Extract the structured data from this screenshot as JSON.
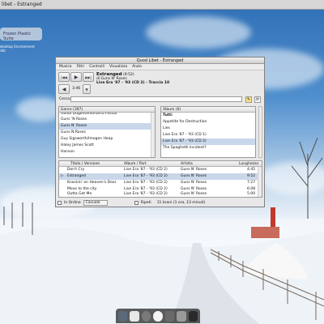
{
  "panel": {
    "title_fragment": "libet - Estranged"
  },
  "desktop": {
    "widget_label": "Frozen Plastic Suite",
    "caption1": "desktop Environment",
    "caption2": "rbit"
  },
  "window": {
    "title": "Quod Libet - Estranged",
    "menu": [
      "Musica",
      "Filtri",
      "Controlli",
      "Visualizza",
      "Aiuto"
    ],
    "now_playing": {
      "title": "Estranged",
      "length": "(9:52)",
      "artist": "di Guns N' Roses",
      "album": "Live Era '87 - '93 (CD 2) - Traccia 10"
    },
    "controls": {
      "prev": "|◀◀",
      "play": "▶",
      "next": "▶▶|",
      "volume_time": "3:46"
    },
    "search": {
      "label": "Cerca:"
    },
    "genre_pane": {
      "header": "Genre (397)",
      "items": [
        "Guido Dugentemonarco Fossat",
        "Guns 'N Roses",
        "Guns N' Roses",
        "Guns N Roses",
        "Guy Sigsworth/Imogen Heap",
        "Haley James Scott",
        "Hanson"
      ],
      "selected_index": 2
    },
    "album_pane": {
      "header": "Album (6)",
      "items": [
        "Tutti",
        "Appetite for Destruction",
        "Lies",
        "Live Era '87 - '93 (CD 1)",
        "Live Era '87 - '93 (CD 2)",
        "The Spaghetti Incident?"
      ],
      "selected_index": 4
    },
    "tracklist": {
      "headers": [
        "Titolo / Versione",
        "Album / Part",
        "Artista",
        "Lunghezza"
      ],
      "rows": [
        {
          "title": "Don't Cry",
          "album": "Live Era '87 - '93 (CD 2)",
          "artist": "Guns N' Roses",
          "length": "4:45",
          "playing": false
        },
        {
          "title": "Estranged",
          "album": "Live Era '87 - '93 (CD 2)",
          "artist": "Guns N' Roses",
          "length": "9:52",
          "playing": true
        },
        {
          "title": "Knockin' on Heaven's Door",
          "album": "Live Era '87 - '93 (CD 2)",
          "artist": "Guns N' Roses",
          "length": "7:27",
          "playing": false
        },
        {
          "title": "Move to the city",
          "album": "Live Era '87 - '93 (CD 2)",
          "artist": "Guns N' Roses",
          "length": "6:08",
          "playing": false
        },
        {
          "title": "Outta Get Me",
          "album": "Live Era '87 - '93 (CD 2)",
          "artist": "Guns N' Roses",
          "length": "5:00",
          "playing": false
        }
      ]
    },
    "footer": {
      "order_label": "In Ordine",
      "order_value": "Casuale",
      "repeat_label": "Ripeti",
      "summary": "11 brani (1 ora, 13 minuti)"
    }
  },
  "dock": {
    "icons": [
      "tv-icon",
      "document-icon",
      "globe-icon",
      "penguin-icon",
      "music-icon",
      "settings-icon",
      "terminal-icon"
    ]
  }
}
